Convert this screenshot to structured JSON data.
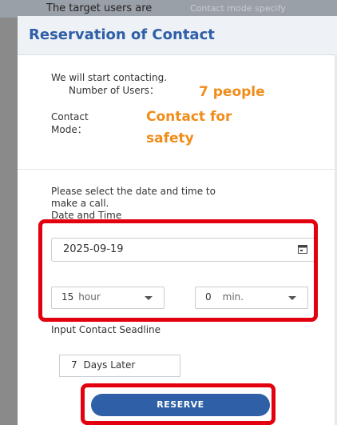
{
  "background": {
    "target_users_text": "The target users are",
    "contact_mode_specify_text": "Contact mode specify"
  },
  "modal": {
    "title": "Reservation of Contact",
    "intro": "We will start contacting.",
    "number_of_users_label": "Number of Users：",
    "number_of_users_value": "7 people",
    "contact_mode_label_line1": "Contact",
    "contact_mode_label_line2": "Mode：",
    "contact_mode_value_line1": "Contact for",
    "contact_mode_value_line2": "safety",
    "schedule_prompt_line1": "Please select the date and time to",
    "schedule_prompt_line2": "make a call.",
    "date_time_label": "Date and Time",
    "date_value": "2025-09-19",
    "hour_value": "15",
    "hour_unit": "hour",
    "minute_value": "0",
    "minute_unit": "min.",
    "deadline_label": "Input Contact Seadline",
    "deadline_value": "7",
    "deadline_unit": "Days Later",
    "reserve_label": "RESERVE"
  },
  "colors": {
    "accent_blue": "#2f5fa6",
    "highlight_orange": "#f08c1a",
    "annotation_red": "#e3000f"
  },
  "icons": {
    "date_picker": "calendar-icon",
    "select_arrow": "caret-down-icon"
  }
}
